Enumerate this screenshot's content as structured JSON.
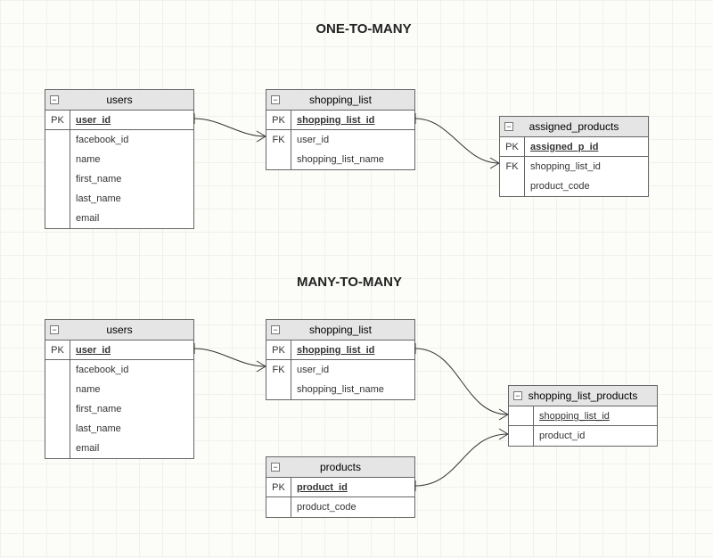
{
  "section1": {
    "title": "ONE-TO-MANY"
  },
  "section2": {
    "title": "MANY-TO-MANY"
  },
  "s1": {
    "users": {
      "name": "users",
      "pk_label": "PK",
      "pk_field": "user_id",
      "fields": [
        "facebook_id",
        "name",
        "first_name",
        "last_name",
        "email"
      ]
    },
    "shopping_list": {
      "name": "shopping_list",
      "pk_label": "PK",
      "pk_field": "shopping_list_id",
      "fk_label": "FK",
      "fk_field": "user_id",
      "fields": [
        "shopping_list_name"
      ]
    },
    "assigned_products": {
      "name": "assigned_products",
      "pk_label": "PK",
      "pk_field": "assigned_p_id",
      "fk_label": "FK",
      "fk_field": "shopping_list_id",
      "fields": [
        "product_code"
      ]
    }
  },
  "s2": {
    "users": {
      "name": "users",
      "pk_label": "PK",
      "pk_field": "user_id",
      "fields": [
        "facebook_id",
        "name",
        "first_name",
        "last_name",
        "email"
      ]
    },
    "shopping_list": {
      "name": "shopping_list",
      "pk_label": "PK",
      "pk_field": "shopping_list_id",
      "fk_label": "FK",
      "fk_field": "user_id",
      "fields": [
        "shopping_list_name"
      ]
    },
    "products": {
      "name": "products",
      "pk_label": "PK",
      "pk_field": "product_id",
      "fields": [
        "product_code"
      ]
    },
    "slp": {
      "name": "shopping_list_products",
      "fields": [
        "shopping_list_id",
        "product_id"
      ]
    }
  }
}
